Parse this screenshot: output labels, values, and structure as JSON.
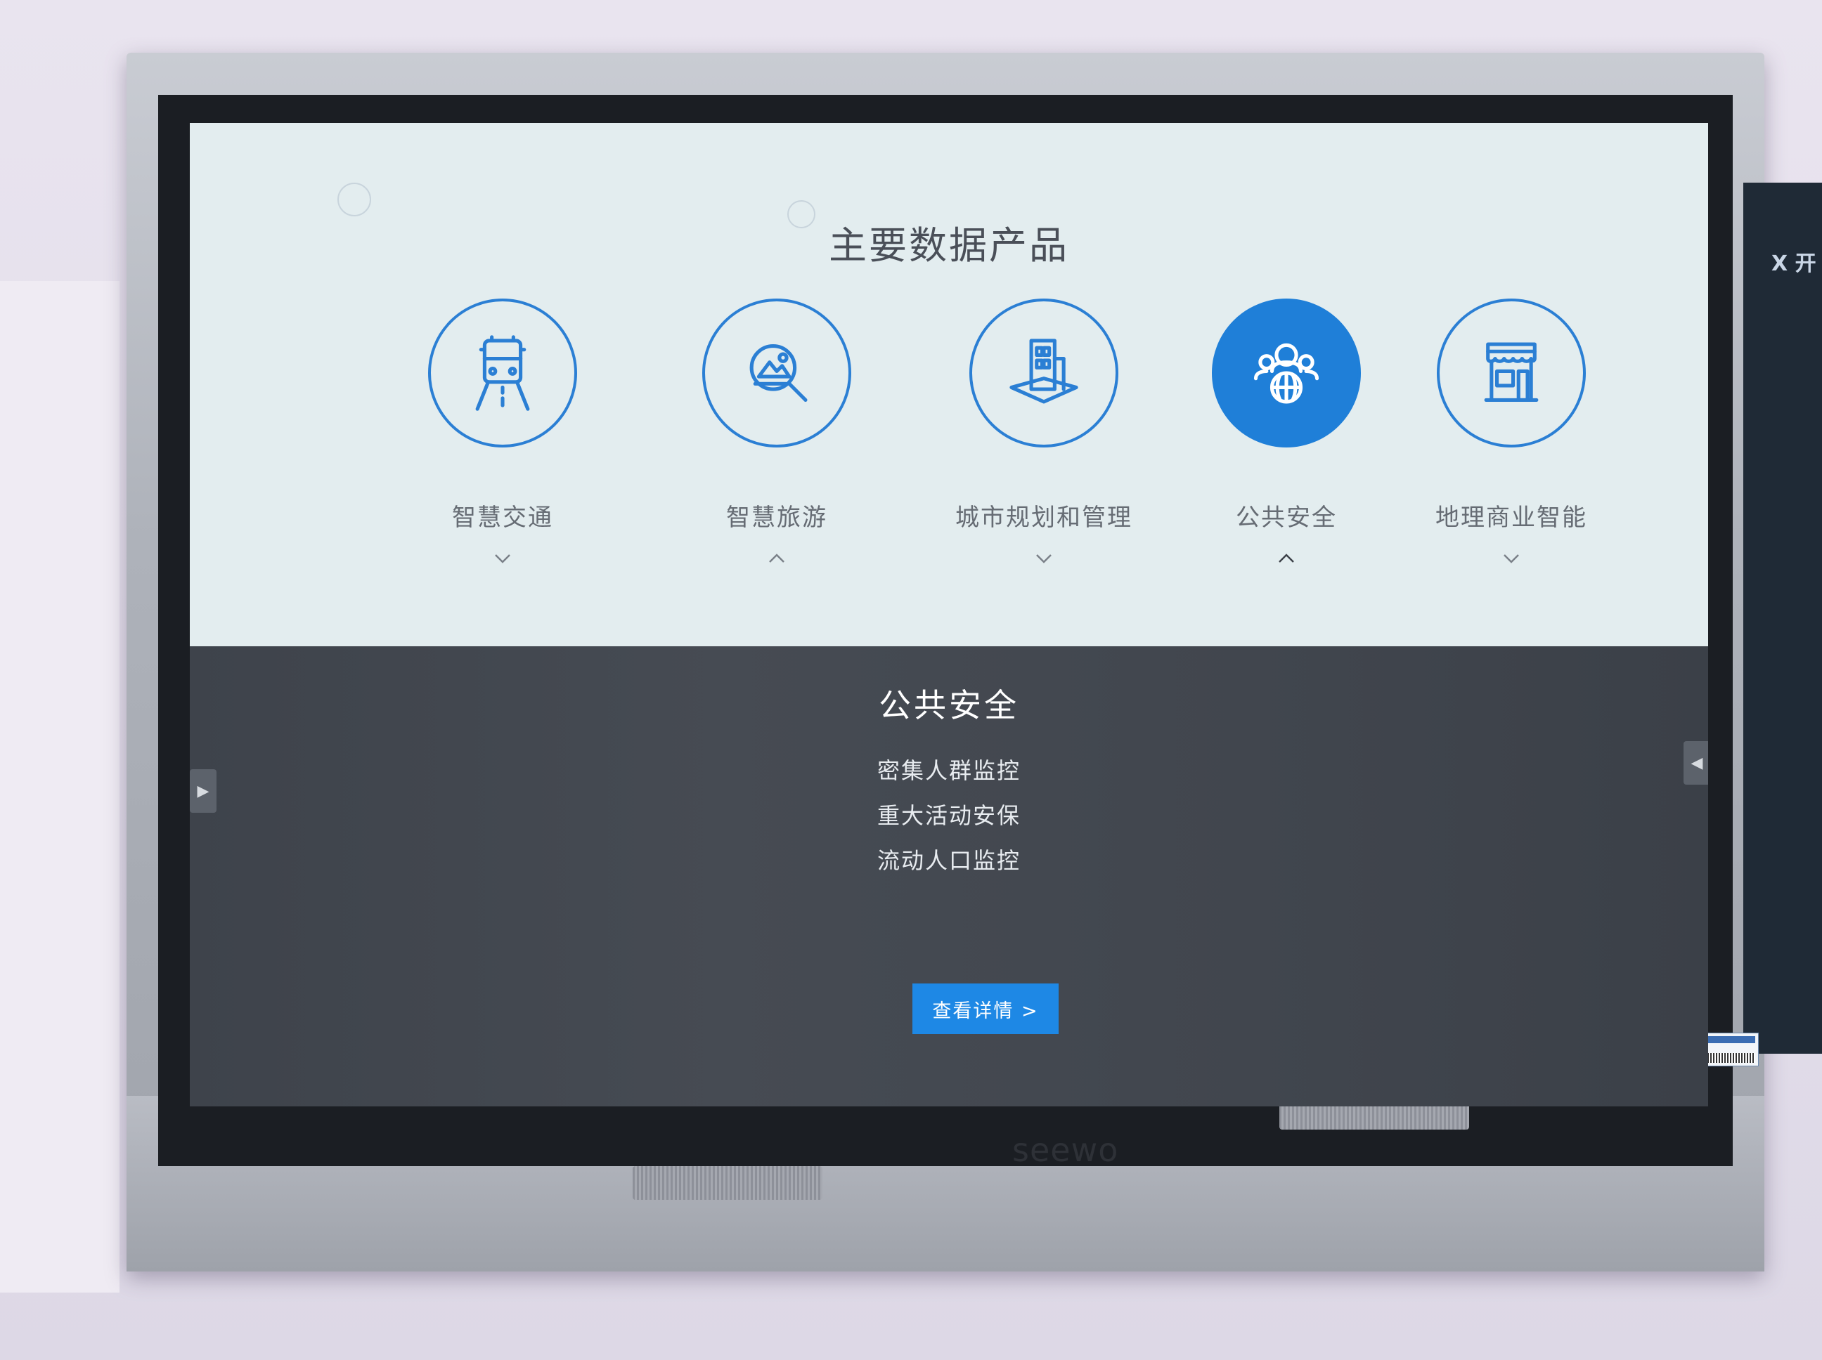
{
  "page": {
    "title": "主要数据产品"
  },
  "products": [
    {
      "label": "智慧交通",
      "icon": "bus-icon",
      "active": false,
      "chevron": "down"
    },
    {
      "label": "智慧旅游",
      "icon": "landscape-search-icon",
      "active": false,
      "chevron": "up"
    },
    {
      "label": "城市规划和管理",
      "icon": "building-icon",
      "active": false,
      "chevron": "down"
    },
    {
      "label": "公共安全",
      "icon": "people-globe-icon",
      "active": true,
      "chevron": "up"
    },
    {
      "label": "地理商业智能",
      "icon": "storefront-icon",
      "active": false,
      "chevron": "down"
    }
  ],
  "detail": {
    "title": "公共安全",
    "items": [
      "密集人群监控",
      "重大活动安保",
      "流动人口监控"
    ],
    "button_label": "查看详情 >"
  },
  "colors": {
    "accent": "#1e88e5",
    "icon_stroke": "#2b7fd4",
    "panel_bg": "#43484f",
    "top_bg": "#e3edef"
  },
  "device": {
    "brand": "seewo"
  },
  "neighbor_screen": {
    "text": "X 开"
  }
}
